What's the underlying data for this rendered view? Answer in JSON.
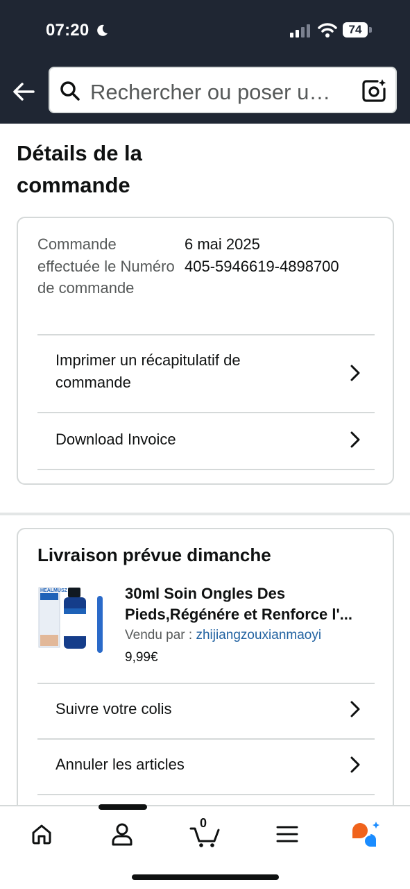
{
  "status_bar": {
    "time": "07:20",
    "battery": "74"
  },
  "search": {
    "placeholder": "Rechercher ou poser u…"
  },
  "page": {
    "title": "Détails de la commande"
  },
  "order_info": {
    "labels": "Commande effectuée le Numéro de commande",
    "date": "6 mai 2025",
    "number": "405-5946619-4898700"
  },
  "order_actions": [
    {
      "label": "Imprimer un récapitulatif de commande"
    },
    {
      "label": "Download Invoice"
    }
  ],
  "delivery": {
    "title": "Livraison prévue dimanche",
    "product": {
      "title_line1": "30ml Soin Ongles Des",
      "title_line2": "Pieds,Régénére et Renforce l'...",
      "seller_prefix": "Vendu par  : ",
      "seller_name": "zhijiangzouxianmaoyi",
      "price": "9,99€",
      "image_text": "HEALMUSZ"
    },
    "actions": [
      {
        "label": "Suivre votre colis"
      },
      {
        "label": "Annuler les articles"
      }
    ]
  },
  "bottom_nav": {
    "cart_count": "0"
  },
  "colors": {
    "topbar": "#1f2633",
    "link": "#2162a1",
    "accent_orange": "#f0631c",
    "accent_blue": "#1a8cff"
  }
}
